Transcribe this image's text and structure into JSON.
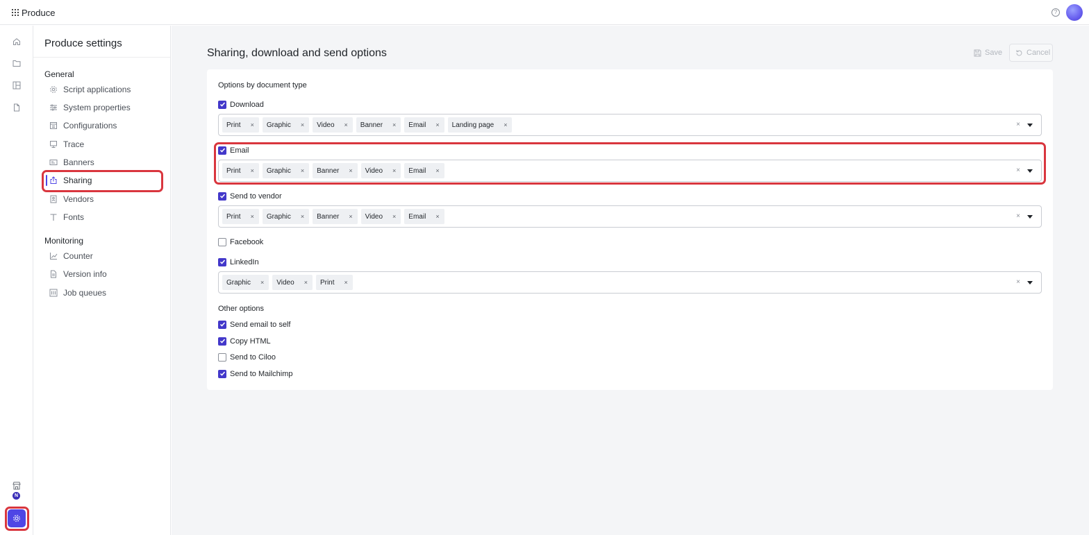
{
  "app": {
    "title": "Produce"
  },
  "topbar": {
    "help_glyph": "?"
  },
  "rail": {
    "items": [
      {
        "icon": "home-icon"
      },
      {
        "icon": "folder-icon"
      },
      {
        "icon": "layout-icon"
      },
      {
        "icon": "document-icon"
      }
    ],
    "store_badge": "N"
  },
  "sidebar": {
    "title": "Produce settings",
    "general_label": "General",
    "general_items": [
      {
        "label": "Script applications",
        "icon": "gear-icon"
      },
      {
        "label": "System properties",
        "icon": "sliders-icon"
      },
      {
        "label": "Configurations",
        "icon": "config-icon"
      },
      {
        "label": "Trace",
        "icon": "monitor-icon"
      },
      {
        "label": "Banners",
        "icon": "banner-icon"
      },
      {
        "label": "Sharing",
        "icon": "share-icon",
        "active": true
      },
      {
        "label": "Vendors",
        "icon": "vendor-icon"
      },
      {
        "label": "Fonts",
        "icon": "font-icon"
      }
    ],
    "monitoring_label": "Monitoring",
    "monitoring_items": [
      {
        "label": "Counter",
        "icon": "chart-icon"
      },
      {
        "label": "Version info",
        "icon": "file-icon"
      },
      {
        "label": "Job queues",
        "icon": "queue-icon"
      }
    ]
  },
  "main": {
    "page_title": "Sharing, download and send options",
    "save_label": "Save",
    "cancel_label": "Cancel",
    "options_heading": "Options by document type",
    "groups": [
      {
        "label": "Download",
        "checked": true,
        "tags": [
          "Print",
          "Graphic",
          "Video",
          "Banner",
          "Email",
          "Landing page"
        ]
      },
      {
        "label": "Email",
        "checked": true,
        "tags": [
          "Print",
          "Graphic",
          "Banner",
          "Video",
          "Email"
        ]
      },
      {
        "label": "Send to vendor",
        "checked": true,
        "tags": [
          "Print",
          "Graphic",
          "Banner",
          "Video",
          "Email"
        ]
      },
      {
        "label": "Facebook",
        "checked": false,
        "tags": []
      },
      {
        "label": "LinkedIn",
        "checked": true,
        "tags": [
          "Graphic",
          "Video",
          "Print"
        ]
      }
    ],
    "other_heading": "Other options",
    "other_options": [
      {
        "label": "Send email to self",
        "checked": true
      },
      {
        "label": "Copy HTML",
        "checked": true
      },
      {
        "label": "Send to Ciloo",
        "checked": false
      },
      {
        "label": "Send to Mailchimp",
        "checked": true
      }
    ],
    "tag_remove_glyph": "×",
    "clear_glyph": "×"
  },
  "colors": {
    "accent": "#4f46e5",
    "highlight": "#d9363e",
    "checkbox": "#4338ca"
  }
}
